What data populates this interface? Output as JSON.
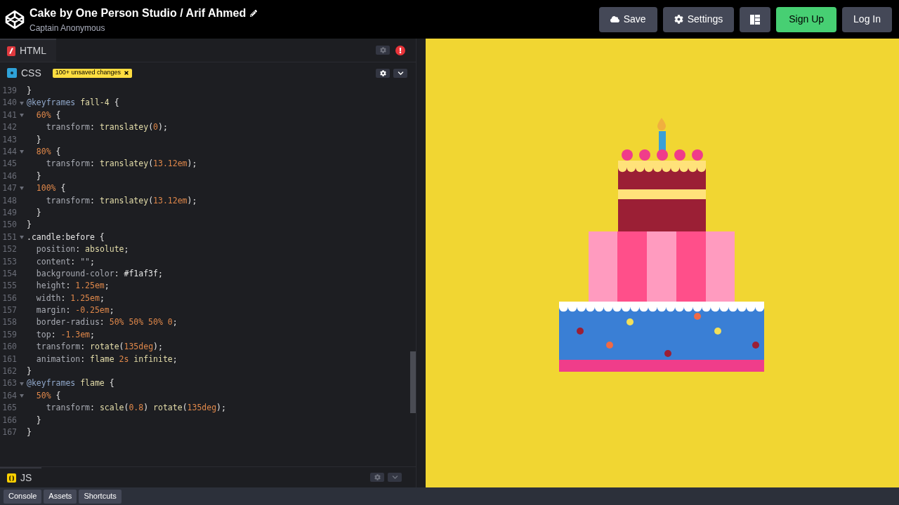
{
  "header": {
    "title": "Cake by One Person Studio / Arif Ahmed",
    "author": "Captain Anonymous",
    "buttons": [
      {
        "kind": "save",
        "label": "Save"
      },
      {
        "kind": "settings",
        "label": "Settings"
      },
      {
        "kind": "layout"
      },
      {
        "kind": "signup",
        "label": "Sign Up"
      },
      {
        "kind": "login",
        "label": "Log In"
      }
    ]
  },
  "editors": [
    {
      "kind": "html",
      "label": "HTML",
      "error": true
    },
    {
      "kind": "css",
      "label": "CSS",
      "badge": "100+ unsaved changes",
      "expanded": true
    }
  ],
  "code_lines": [
    {
      "number": "139",
      "foldable": false,
      "tokens": [
        {
          "kind": "punct",
          "text": "}"
        }
      ]
    },
    {
      "number": "140",
      "foldable": true,
      "tokens": [
        {
          "kind": "at",
          "text": "@keyframes"
        },
        {
          "kind": "name",
          "text": " fall-4"
        },
        {
          "kind": "punct",
          "text": " {"
        }
      ]
    },
    {
      "number": "141",
      "foldable": true,
      "tokens": [
        {
          "kind": "num",
          "text": "  60%"
        },
        {
          "kind": "punct",
          "text": " {"
        }
      ]
    },
    {
      "number": "142",
      "foldable": false,
      "tokens": [
        {
          "kind": "prop",
          "text": "    transform"
        },
        {
          "kind": "punct",
          "text": ": "
        },
        {
          "kind": "name",
          "text": "translatey"
        },
        {
          "kind": "punct",
          "text": "("
        },
        {
          "kind": "num",
          "text": "0"
        },
        {
          "kind": "punct",
          "text": ");"
        }
      ]
    },
    {
      "number": "143",
      "foldable": false,
      "tokens": [
        {
          "kind": "punct",
          "text": "  }"
        }
      ]
    },
    {
      "number": "144",
      "foldable": true,
      "tokens": [
        {
          "kind": "num",
          "text": "  80%"
        },
        {
          "kind": "punct",
          "text": " {"
        }
      ]
    },
    {
      "number": "145",
      "foldable": false,
      "tokens": [
        {
          "kind": "prop",
          "text": "    transform"
        },
        {
          "kind": "punct",
          "text": ": "
        },
        {
          "kind": "name",
          "text": "translatey"
        },
        {
          "kind": "punct",
          "text": "("
        },
        {
          "kind": "num",
          "text": "13.12em"
        },
        {
          "kind": "punct",
          "text": ");"
        }
      ]
    },
    {
      "number": "146",
      "foldable": false,
      "tokens": [
        {
          "kind": "punct",
          "text": "  }"
        }
      ]
    },
    {
      "number": "147",
      "foldable": true,
      "tokens": [
        {
          "kind": "num",
          "text": "  100%"
        },
        {
          "kind": "punct",
          "text": " {"
        }
      ]
    },
    {
      "number": "148",
      "foldable": false,
      "tokens": [
        {
          "kind": "prop",
          "text": "    transform"
        },
        {
          "kind": "punct",
          "text": ": "
        },
        {
          "kind": "name",
          "text": "translatey"
        },
        {
          "kind": "punct",
          "text": "("
        },
        {
          "kind": "num",
          "text": "13.12em"
        },
        {
          "kind": "punct",
          "text": ");"
        }
      ]
    },
    {
      "number": "149",
      "foldable": false,
      "tokens": [
        {
          "kind": "punct",
          "text": "  }"
        }
      ]
    },
    {
      "number": "150",
      "foldable": false,
      "tokens": [
        {
          "kind": "punct",
          "text": "}"
        }
      ]
    },
    {
      "number": "151",
      "foldable": true,
      "tokens": [
        {
          "kind": "sel",
          "text": ".candle"
        },
        {
          "kind": "punct",
          "text": ":before {"
        }
      ]
    },
    {
      "number": "152",
      "foldable": false,
      "tokens": [
        {
          "kind": "prop",
          "text": "  position"
        },
        {
          "kind": "punct",
          "text": ": "
        },
        {
          "kind": "name",
          "text": "absolute"
        },
        {
          "kind": "punct",
          "text": ";"
        }
      ]
    },
    {
      "number": "153",
      "foldable": false,
      "tokens": [
        {
          "kind": "prop",
          "text": "  content"
        },
        {
          "kind": "punct",
          "text": ": "
        },
        {
          "kind": "prop",
          "text": "\"\""
        },
        {
          "kind": "punct",
          "text": ";"
        }
      ]
    },
    {
      "number": "154",
      "foldable": false,
      "tokens": [
        {
          "kind": "prop",
          "text": "  background-color"
        },
        {
          "kind": "punct",
          "text": ": #f1af3f;"
        }
      ]
    },
    {
      "number": "155",
      "foldable": false,
      "tokens": [
        {
          "kind": "prop",
          "text": "  height"
        },
        {
          "kind": "punct",
          "text": ": "
        },
        {
          "kind": "num",
          "text": "1.25em"
        },
        {
          "kind": "punct",
          "text": ";"
        }
      ]
    },
    {
      "number": "156",
      "foldable": false,
      "tokens": [
        {
          "kind": "prop",
          "text": "  width"
        },
        {
          "kind": "punct",
          "text": ": "
        },
        {
          "kind": "num",
          "text": "1.25em"
        },
        {
          "kind": "punct",
          "text": ";"
        }
      ]
    },
    {
      "number": "157",
      "foldable": false,
      "tokens": [
        {
          "kind": "prop",
          "text": "  margin"
        },
        {
          "kind": "punct",
          "text": ": "
        },
        {
          "kind": "num",
          "text": "-0.25em"
        },
        {
          "kind": "punct",
          "text": ";"
        }
      ]
    },
    {
      "number": "158",
      "foldable": false,
      "tokens": [
        {
          "kind": "prop",
          "text": "  border-radius"
        },
        {
          "kind": "punct",
          "text": ": "
        },
        {
          "kind": "num",
          "text": "50% 50% 50% 0"
        },
        {
          "kind": "punct",
          "text": ";"
        }
      ]
    },
    {
      "number": "159",
      "foldable": false,
      "tokens": [
        {
          "kind": "prop",
          "text": "  top"
        },
        {
          "kind": "punct",
          "text": ": "
        },
        {
          "kind": "num",
          "text": "-1.3em"
        },
        {
          "kind": "punct",
          "text": ";"
        }
      ]
    },
    {
      "number": "160",
      "foldable": false,
      "tokens": [
        {
          "kind": "prop",
          "text": "  transform"
        },
        {
          "kind": "punct",
          "text": ": "
        },
        {
          "kind": "name",
          "text": "rotate"
        },
        {
          "kind": "punct",
          "text": "("
        },
        {
          "kind": "num",
          "text": "135deg"
        },
        {
          "kind": "punct",
          "text": ");"
        }
      ]
    },
    {
      "number": "161",
      "foldable": false,
      "tokens": [
        {
          "kind": "prop",
          "text": "  animation"
        },
        {
          "kind": "punct",
          "text": ": "
        },
        {
          "kind": "name",
          "text": "flame"
        },
        {
          "kind": "num",
          "text": " 2s"
        },
        {
          "kind": "name",
          "text": " infinite"
        },
        {
          "kind": "punct",
          "text": ";"
        }
      ]
    },
    {
      "number": "162",
      "foldable": false,
      "tokens": [
        {
          "kind": "punct",
          "text": "}"
        }
      ]
    },
    {
      "number": "163",
      "foldable": true,
      "tokens": [
        {
          "kind": "at",
          "text": "@keyframes"
        },
        {
          "kind": "name",
          "text": " flame"
        },
        {
          "kind": "punct",
          "text": " {"
        }
      ]
    },
    {
      "number": "164",
      "foldable": true,
      "tokens": [
        {
          "kind": "num",
          "text": "  50%"
        },
        {
          "kind": "punct",
          "text": " {"
        }
      ]
    },
    {
      "number": "165",
      "foldable": false,
      "tokens": [
        {
          "kind": "prop",
          "text": "    transform"
        },
        {
          "kind": "punct",
          "text": ": "
        },
        {
          "kind": "name",
          "text": "scale"
        },
        {
          "kind": "punct",
          "text": "("
        },
        {
          "kind": "num",
          "text": "0.8"
        },
        {
          "kind": "punct",
          "text": ") "
        },
        {
          "kind": "name",
          "text": "rotate"
        },
        {
          "kind": "punct",
          "text": "("
        },
        {
          "kind": "num",
          "text": "135deg"
        },
        {
          "kind": "punct",
          "text": ");"
        }
      ]
    },
    {
      "number": "166",
      "foldable": false,
      "tokens": [
        {
          "kind": "punct",
          "text": "  }"
        }
      ]
    },
    {
      "number": "167",
      "foldable": false,
      "tokens": [
        {
          "kind": "punct",
          "text": "}"
        }
      ]
    }
  ],
  "js_editor": {
    "label": "JS"
  },
  "bottom_tabs": [
    "Console",
    "Assets",
    "Shortcuts"
  ]
}
